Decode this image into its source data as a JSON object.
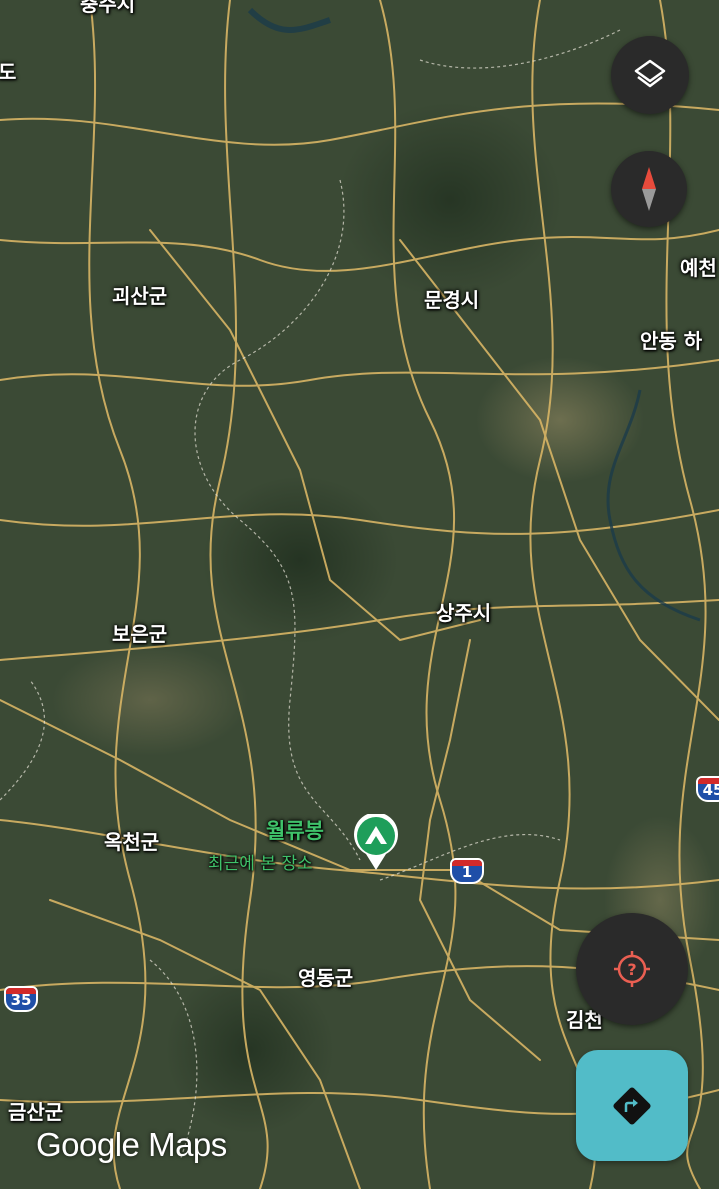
{
  "map": {
    "place_labels": [
      {
        "name": "충주시",
        "id": "chungju"
      },
      {
        "name": "도",
        "id": "do"
      },
      {
        "name": "괴산군",
        "id": "goesan"
      },
      {
        "name": "문경시",
        "id": "mungyeong"
      },
      {
        "name": "예천",
        "id": "yecheon"
      },
      {
        "name": "안동 하",
        "id": "andong"
      },
      {
        "name": "보은군",
        "id": "boeun"
      },
      {
        "name": "상주시",
        "id": "sangju"
      },
      {
        "name": "옥천군",
        "id": "okcheon"
      },
      {
        "name": "영동군",
        "id": "yeongdong"
      },
      {
        "name": "김천",
        "id": "gimcheon"
      },
      {
        "name": "금산군",
        "id": "geumsan"
      }
    ],
    "route_shields": [
      {
        "number": "45",
        "id": "45"
      },
      {
        "number": "1",
        "id": "1"
      },
      {
        "number": "35",
        "id": "35"
      }
    ],
    "poi": {
      "name": "월류봉",
      "subtitle": "최근에 본 장소",
      "marker_icon": "mountain-icon",
      "marker_color": "#1e9e5a"
    }
  },
  "controls": {
    "layers_icon": "layers-icon",
    "compass_icon": "compass-icon",
    "locate_icon": "my-location-icon",
    "locate_color": "#ea5f52",
    "directions_icon": "directions-icon",
    "directions_color": "#52bcc8"
  },
  "branding": {
    "text": "Google Maps"
  }
}
